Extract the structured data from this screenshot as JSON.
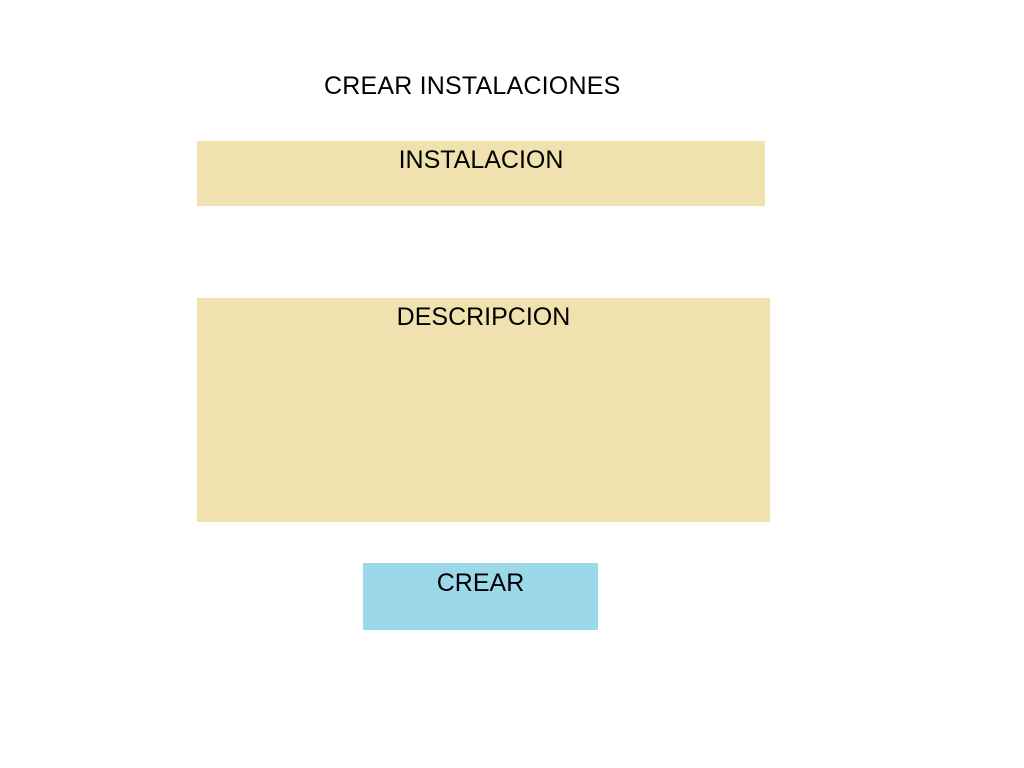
{
  "form": {
    "title": "CREAR INSTALACIONES",
    "fields": {
      "instalacion": {
        "label": "INSTALACION"
      },
      "descripcion": {
        "label": "DESCRIPCION"
      }
    },
    "submit_label": "CREAR"
  },
  "colors": {
    "field_background": "#EFE2AF",
    "button_background": "#9BD8EA",
    "text": "#000000",
    "page_background": "#FFFFFF"
  }
}
